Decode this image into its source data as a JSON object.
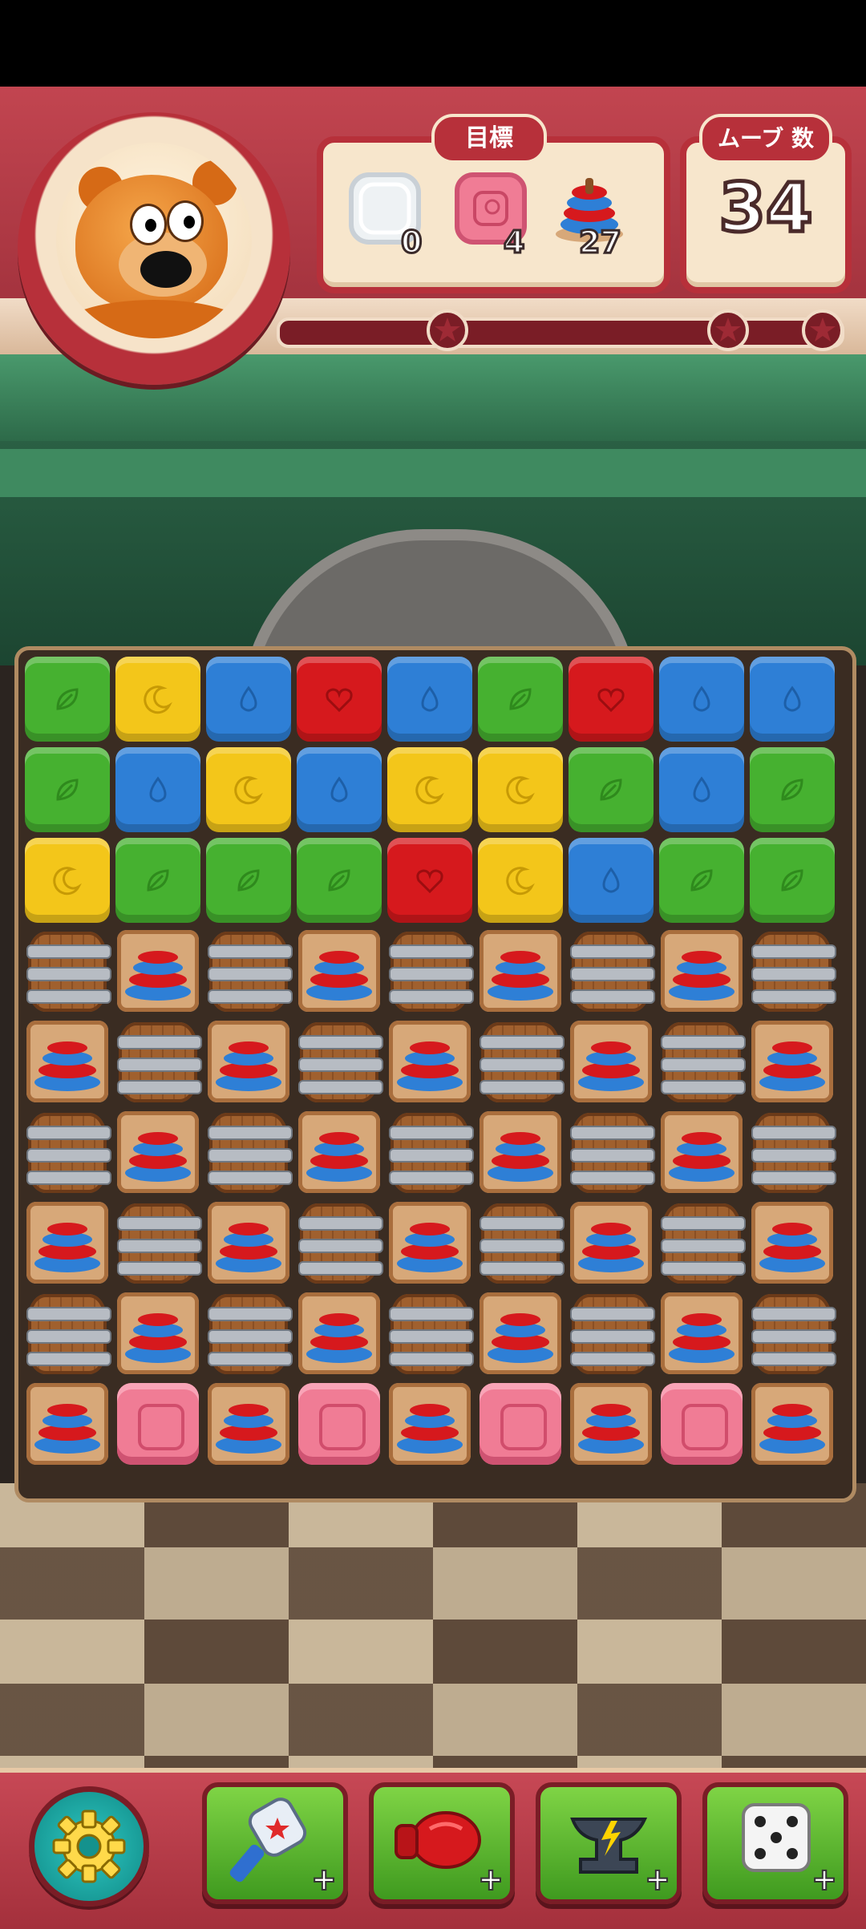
{
  "hud": {
    "goal_title": "目標",
    "moves_label": "ムーブ 数",
    "moves_value": "34",
    "goals": [
      {
        "icon": "bubble-icon",
        "count": "0"
      },
      {
        "icon": "duck-block-icon",
        "count": "4"
      },
      {
        "icon": "ring-stack-icon",
        "count": "27"
      }
    ],
    "progress_stars": 3
  },
  "board": {
    "columns": 9,
    "rows": [
      [
        "green",
        "yellow",
        "blue",
        "red",
        "blue",
        "green",
        "red",
        "blue",
        "blue"
      ],
      [
        "green",
        "blue",
        "yellow",
        "blue",
        "yellow",
        "yellow",
        "green",
        "blue",
        "green"
      ],
      [
        "yellow",
        "green",
        "green",
        "green",
        "red",
        "yellow",
        "blue",
        "green",
        "green"
      ],
      [
        "barrel",
        "ring",
        "barrel",
        "ring",
        "barrel",
        "ring",
        "barrel",
        "ring",
        "barrel"
      ],
      [
        "ring",
        "barrel",
        "ring",
        "barrel",
        "ring",
        "barrel",
        "ring",
        "barrel",
        "ring"
      ],
      [
        "barrel",
        "ring",
        "barrel",
        "ring",
        "barrel",
        "ring",
        "barrel",
        "ring",
        "barrel"
      ],
      [
        "ring",
        "barrel",
        "ring",
        "barrel",
        "ring",
        "barrel",
        "ring",
        "barrel",
        "ring"
      ],
      [
        "barrel",
        "ring",
        "barrel",
        "ring",
        "barrel",
        "ring",
        "barrel",
        "ring",
        "barrel"
      ],
      [
        "ring",
        "duck",
        "ring",
        "duck",
        "ring",
        "duck",
        "ring",
        "duck",
        "ring"
      ]
    ],
    "colors": {
      "green": "#46b130",
      "yellow": "#f3c61a",
      "blue": "#2e7fd6",
      "red": "#d6191d",
      "duck": "#f07c95"
    }
  },
  "bottom": {
    "boosters": [
      {
        "name": "hammer-booster",
        "icon": "hammer-icon"
      },
      {
        "name": "boxing-glove-booster",
        "icon": "boxing-glove-icon"
      },
      {
        "name": "anvil-booster",
        "icon": "anvil-icon"
      },
      {
        "name": "dice-booster",
        "icon": "dice-icon"
      }
    ],
    "plus_symbol": "+"
  }
}
